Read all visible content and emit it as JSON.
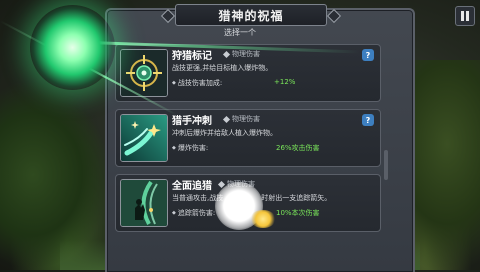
{
  "header": {
    "title": "猎神的祝福",
    "subtitle": "选择一个"
  },
  "cards": [
    {
      "name": "狩猎标记",
      "type": "物理伤害",
      "desc": "战技更强,并给目标植入爆炸物。",
      "stat_label": "战技伤害加成:",
      "stat_value": "+12%",
      "icon": "crosshair-icon",
      "has_help": true
    },
    {
      "name": "猎手冲刺",
      "type": "物理伤害",
      "desc": "冲刺后爆炸并给敌人植入爆炸物。",
      "stat_label": "爆炸伤害:",
      "stat_value": "26%攻击伤害",
      "icon": "dash-icon",
      "has_help": true
    },
    {
      "name": "全面追猎",
      "type": "物理伤害",
      "desc_left": "当普通攻击,战技",
      "desc_right": "时射出一支追踪箭矢。",
      "stat_label": "追踪箭伤害:",
      "stat_value": "10%本次伤害",
      "icon": "hunter-arrow-icon",
      "has_help": false
    }
  ],
  "help_label": "?",
  "colors": {
    "stat_value": "#7ae65a",
    "help_badge": "#3d7fc0",
    "glow": "#21c86e"
  }
}
